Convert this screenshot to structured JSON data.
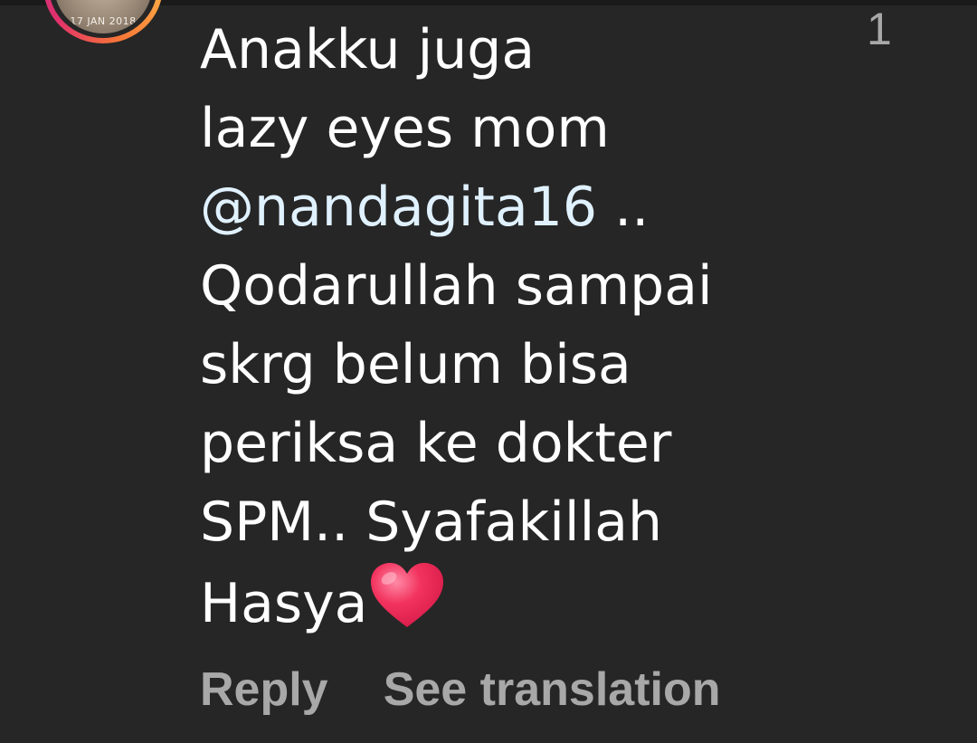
{
  "avatar": {
    "stamp_text": "17 JAN 2018"
  },
  "like_count": "1",
  "comment": {
    "lines": [
      {
        "text": "Anakku juga"
      },
      {
        "text": "lazy eyes mom"
      },
      {
        "mention": "@nandagita16",
        "text": " .."
      },
      {
        "text": "Qodarullah sampai"
      },
      {
        "text": "skrg belum bisa"
      },
      {
        "text": "periksa ke dokter"
      },
      {
        "text": "SPM.. Syafakillah"
      },
      {
        "text": "Hasya"
      }
    ],
    "emoji": "heart-icon"
  },
  "actions": {
    "reply_label": "Reply",
    "translate_label": "See translation"
  },
  "colors": {
    "background": "#262626",
    "text": "#ffffff",
    "secondary_text": "#a8a8a8",
    "mention": "#e0f1ff",
    "heart": "#f2335e"
  }
}
